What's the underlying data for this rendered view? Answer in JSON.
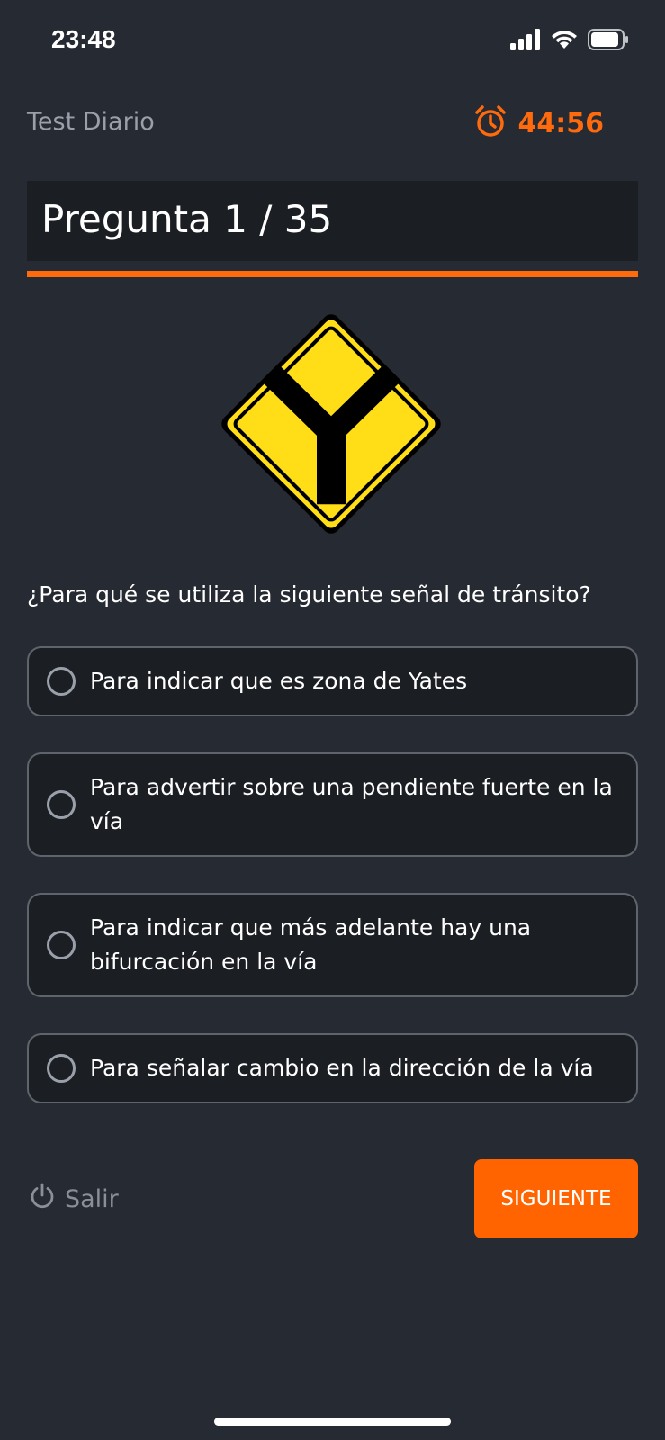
{
  "status_bar": {
    "time": "23:48",
    "icons": [
      "signal-icon",
      "wifi-icon",
      "battery-icon"
    ]
  },
  "header": {
    "title": "Test Diario",
    "timer_icon": "alarm-clock-icon",
    "timer": "44:56"
  },
  "question": {
    "counter": "Pregunta 1 / 35",
    "progress": 1.0,
    "sign_icon": "y-junction-road-sign",
    "text": "¿Para qué se utiliza la siguiente señal de tránsito?"
  },
  "options": [
    {
      "label": "Para indicar que es zona de Yates"
    },
    {
      "label": "Para advertir sobre una pendiente fuerte en la vía"
    },
    {
      "label": "Para indicar que más adelante hay una bifurcación en la vía"
    },
    {
      "label": "Para señalar cambio en la dirección de la vía"
    }
  ],
  "footer": {
    "exit_icon": "power-icon",
    "exit_label": "Salir",
    "next_label": "SIGUIENTE"
  },
  "colors": {
    "background": "#262a32",
    "accent": "#ff6a0d",
    "card": "#1b1e23",
    "sign_yellow": "#ffde17"
  }
}
